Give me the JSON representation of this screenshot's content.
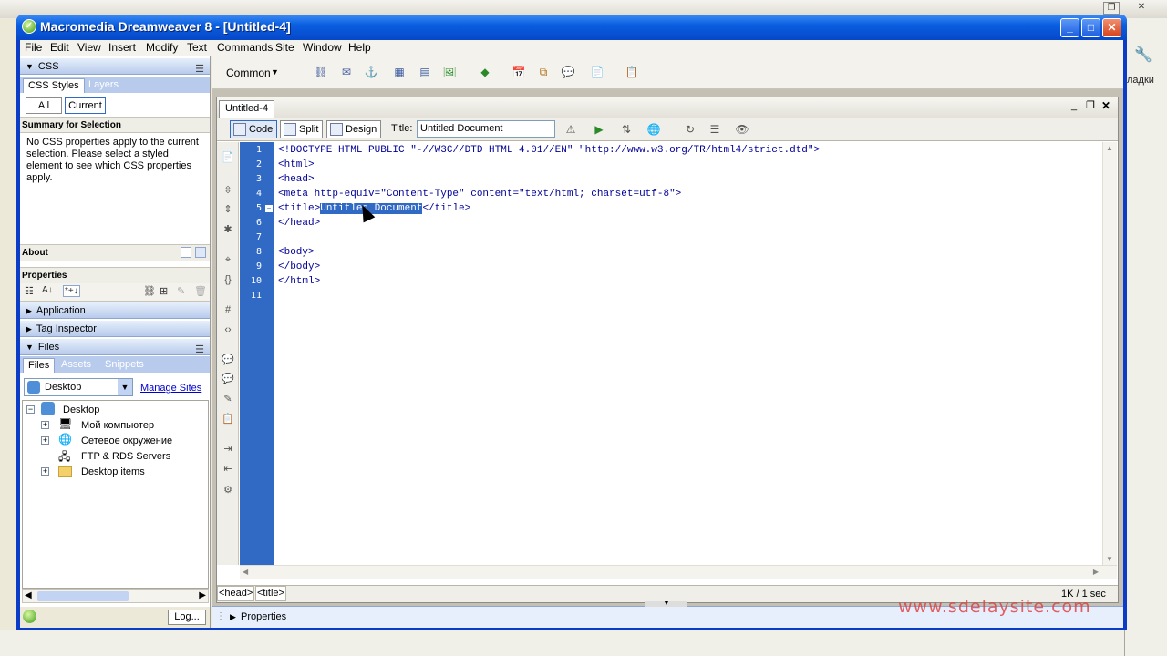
{
  "window": {
    "title": "Macromedia Dreamweaver 8 - [Untitled-4]",
    "app_icon": "dreamweaver-icon"
  },
  "background": {
    "right_text": "ладки"
  },
  "menu": [
    "File",
    "Edit",
    "View",
    "Insert",
    "Modify",
    "Text",
    "Commands",
    "Site",
    "Window",
    "Help"
  ],
  "insert_bar": {
    "category": "Common"
  },
  "css_panel": {
    "title": "CSS",
    "tabs": [
      "CSS Styles",
      "Layers"
    ],
    "mode_buttons": [
      "All",
      "Current"
    ],
    "summary_header": "Summary for Selection",
    "summary_text": "No CSS properties apply to the current selection.  Please select a styled element to see which CSS properties apply.",
    "about_header": "About",
    "properties_header": "Properties"
  },
  "collapsed_panels": [
    "Application",
    "Tag Inspector"
  ],
  "files_panel": {
    "title": "Files",
    "tabs": [
      "Files",
      "Assets",
      "Snippets"
    ],
    "site_select": "Desktop",
    "manage_sites": "Manage Sites",
    "tree_root": "Desktop",
    "tree": [
      {
        "label": "Мой компьютер",
        "expandable": true
      },
      {
        "label": "Сетевое окружение",
        "expandable": true
      },
      {
        "label": "FTP & RDS Servers",
        "expandable": false
      },
      {
        "label": "Desktop items",
        "expandable": true
      }
    ],
    "log_button": "Log..."
  },
  "document": {
    "tab": "Untitled-4",
    "view_buttons": [
      "Code",
      "Split",
      "Design"
    ],
    "title_label": "Title:",
    "title_value": "Untitled Document",
    "line_numbers": [
      "1",
      "2",
      "3",
      "4",
      "5",
      "6",
      "7",
      "8",
      "9",
      "10",
      "11"
    ],
    "code_lines": [
      "<!DOCTYPE HTML PUBLIC \"-//W3C//DTD HTML 4.01//EN\" \"http://www.w3.org/TR/html4/strict.dtd\">",
      "<html>",
      "<head>",
      "<meta http-equiv=\"Content-Type\" content=\"text/html; charset=utf-8\">",
      "",
      "</head>",
      "",
      "<body>",
      "</body>",
      "</html>",
      ""
    ],
    "line5": {
      "before": "<title>",
      "selected": "Untitled Document",
      "after": "</title>"
    },
    "tag_path": [
      "<head>",
      "<title>"
    ],
    "size_info": "1K / 1 sec"
  },
  "properties_bar": "Properties",
  "watermark": "www.sdelaysite.com"
}
